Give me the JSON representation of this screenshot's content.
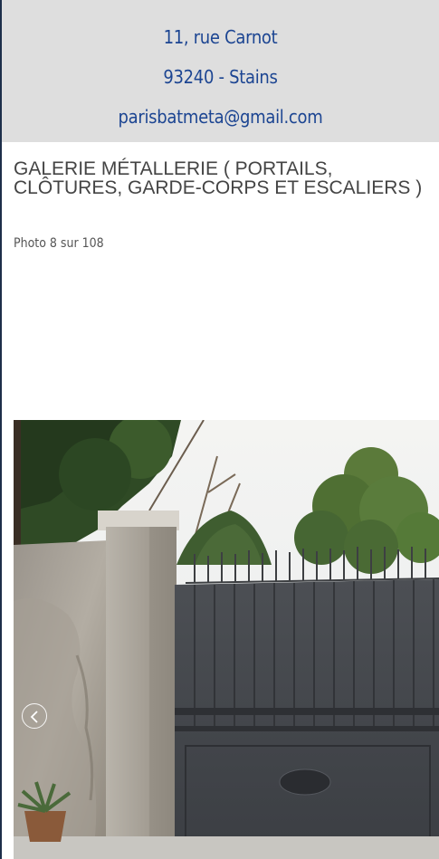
{
  "contact": {
    "address": "11, rue Carnot",
    "city": "93240 - Stains",
    "email": "parisbatmeta@gmail.com"
  },
  "gallery": {
    "title": "GALERIE MÉTALLERIE ( PORTAILS, CLÔTURES, GARDE-CORPS ET ESCALIERS )",
    "photo_counter": "Photo 8 sur 108",
    "current_photo": 8,
    "total_photos": 108,
    "prev_icon": "chevron-left-icon"
  },
  "colors": {
    "contact_bg": "#dedede",
    "contact_text": "#1c4592",
    "title_text": "#444444"
  }
}
